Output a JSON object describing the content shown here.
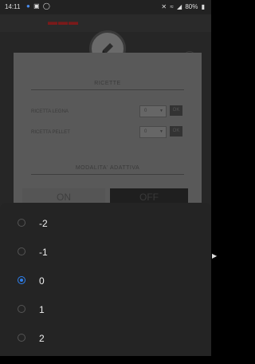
{
  "status_bar": {
    "time": "14:11",
    "notification_icons": [
      "messenger-icon",
      "image-icon",
      "whatsapp-icon"
    ],
    "battery": "80%"
  },
  "dialog": {
    "section_recipes_title": "RICETTE",
    "recipe_wood_label": "RICETTA LEGNA",
    "recipe_wood_value": "0",
    "recipe_pellet_label": "RICETTA PELLET",
    "recipe_pellet_value": "0",
    "ok_label": "OK",
    "section_adaptive_title": "MODALITA' ADATTIVA",
    "toggle_on_label": "ON",
    "toggle_off_label": "OFF"
  },
  "picker": {
    "options": [
      {
        "label": "-2",
        "selected": false
      },
      {
        "label": "-1",
        "selected": false
      },
      {
        "label": "0",
        "selected": true
      },
      {
        "label": "1",
        "selected": false
      },
      {
        "label": "2",
        "selected": false
      }
    ]
  },
  "colors": {
    "accent": "#2f80ed",
    "sheet_bg": "#242424"
  }
}
